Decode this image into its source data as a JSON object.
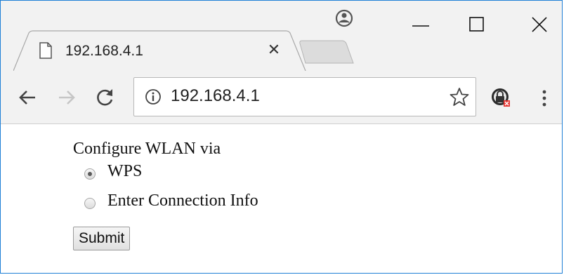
{
  "browser": {
    "tab": {
      "title": "192.168.4.1",
      "close_glyph": "✕",
      "icon": "page-icon"
    },
    "address_bar": {
      "url": "192.168.4.1",
      "security_icon": "info-icon"
    },
    "accent_border": "#1e7fd6"
  },
  "page": {
    "heading": "Configure WLAN via",
    "options": [
      {
        "label": "WPS",
        "checked": true
      },
      {
        "label": "Enter Connection Info",
        "checked": false
      }
    ],
    "submit_label": "Submit"
  }
}
